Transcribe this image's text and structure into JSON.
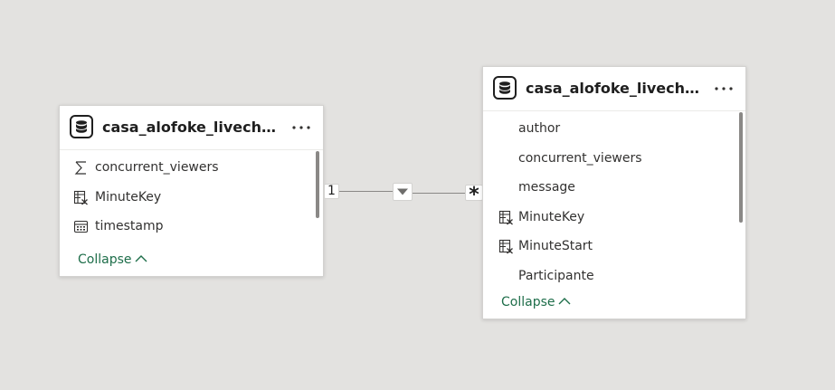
{
  "tables": [
    {
      "title": "casa_alofoke_livechat_ss",
      "icon": "database-icon",
      "fields": [
        {
          "label": "concurrent_viewers",
          "icon": "sigma-icon"
        },
        {
          "label": "MinuteKey",
          "icon": "calculated-column-icon"
        },
        {
          "label": "timestamp",
          "icon": "calendar-icon"
        }
      ],
      "collapse_label": "Collapse"
    },
    {
      "title": "casa_alofoke_livechat_d...",
      "icon": "database-icon",
      "fields": [
        {
          "label": "author",
          "icon": ""
        },
        {
          "label": "concurrent_viewers",
          "icon": ""
        },
        {
          "label": "message",
          "icon": ""
        },
        {
          "label": "MinuteKey",
          "icon": "calculated-column-icon"
        },
        {
          "label": "MinuteStart",
          "icon": "calculated-column-icon"
        },
        {
          "label": "Participante",
          "icon": ""
        }
      ],
      "collapse_label": "Collapse"
    }
  ],
  "relationship": {
    "from_cardinality": "1",
    "to_cardinality": "*",
    "filter_direction_icon": "triangle-down-icon"
  },
  "colors": {
    "canvas": "#e3e2e0",
    "accent": "#1e6e4a",
    "line": "#8a8886"
  }
}
